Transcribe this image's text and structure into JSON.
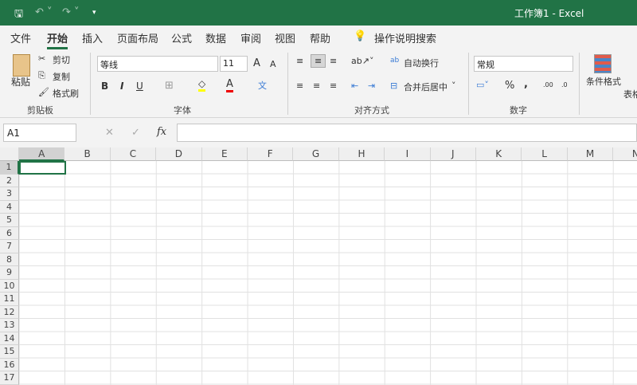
{
  "title": "工作簿1 - Excel",
  "quick_access": {
    "save": "save-icon",
    "undo": "undo-icon",
    "redo": "redo-icon",
    "customize": "customize-icon"
  },
  "menu": [
    "文件",
    "开始",
    "插入",
    "页面布局",
    "公式",
    "数据",
    "审阅",
    "视图",
    "帮助"
  ],
  "search": "操作说明搜索",
  "clipboard": {
    "paste": "粘贴",
    "cut": "剪切",
    "copy": "复制",
    "format_painter": "格式刷",
    "group": "剪贴板"
  },
  "font": {
    "name": "等线",
    "size": "11",
    "bold": "B",
    "italic": "I",
    "underline": "U",
    "grow": "A",
    "shrink": "A",
    "color": "A",
    "group": "字体",
    "fill_color": "#ffff00",
    "font_color": "#ff0000"
  },
  "alignment": {
    "wrap": "自动换行",
    "merge": "合并后居中",
    "group": "对齐方式"
  },
  "number": {
    "format": "常规",
    "percent": "%",
    "comma": ",",
    "inc": ".00",
    "dec": ".0",
    "group": "数字"
  },
  "styles": {
    "conditional": "条件格式",
    "table": "表格"
  },
  "formula_bar": {
    "name_box": "A1",
    "fx": "fx",
    "cancel": "✕",
    "enter": "✓",
    "value": ""
  },
  "columns": [
    "A",
    "B",
    "C",
    "D",
    "E",
    "F",
    "G",
    "H",
    "I",
    "J",
    "K",
    "L",
    "M",
    "N"
  ],
  "rows": [
    "1",
    "2",
    "3",
    "4",
    "5",
    "6",
    "7",
    "8",
    "9",
    "10",
    "11",
    "12",
    "13",
    "14",
    "15",
    "16",
    "17"
  ],
  "accent": "#217346"
}
